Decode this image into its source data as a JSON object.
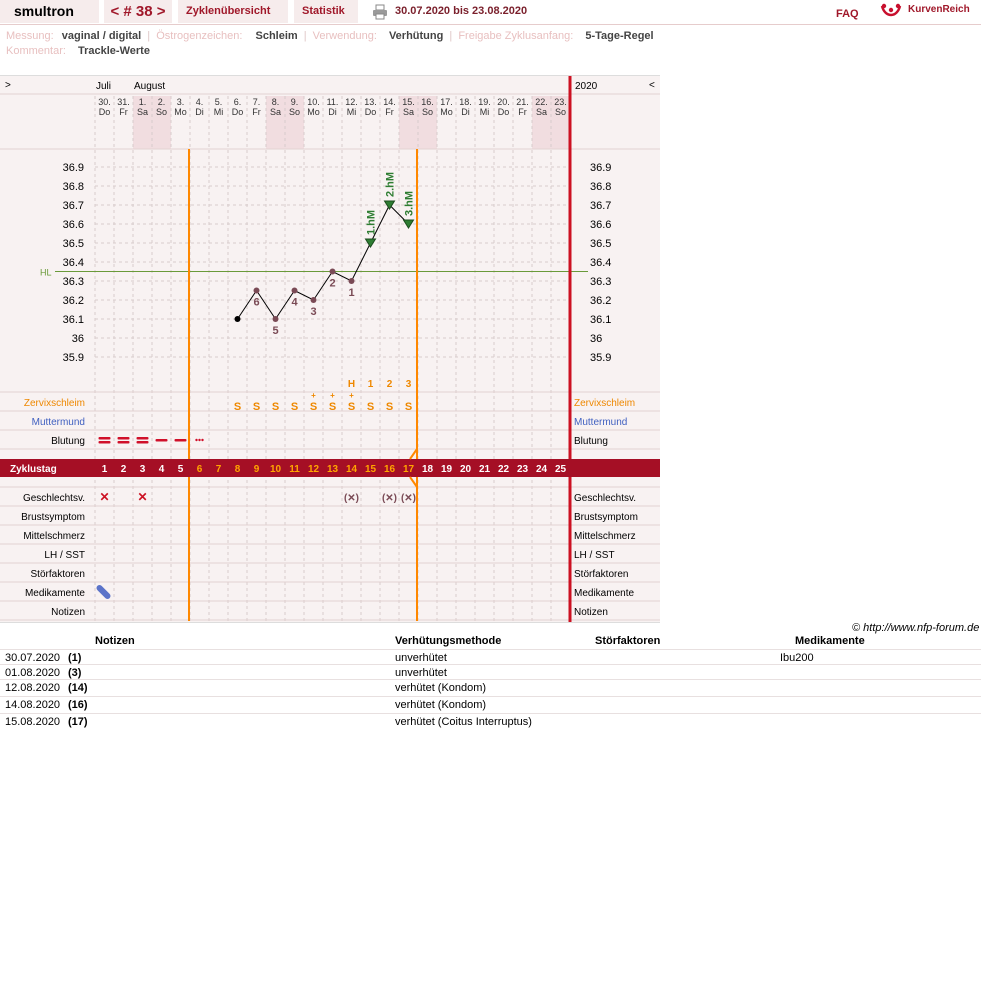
{
  "topbar": {
    "username": "smultron",
    "cycle_nav": "< # 38 >",
    "tab_overview": "Zyklenübersicht",
    "tab_stats": "Statistik",
    "date_range": "30.07.2020 bis 23.08.2020",
    "faq": "FAQ",
    "brand": "KurvenReich"
  },
  "meta": {
    "messung_label": "Messung:",
    "messung_val": "vaginal / digital",
    "oestrogen_label": "Östrogenzeichen:",
    "oestrogen_val": "Schleim",
    "verwendung_label": "Verwendung:",
    "verwendung_val": "Verhütung",
    "freigabe_label": "Freigabe Zyklusanfang:",
    "freigabe_val": "5-Tage-Regel",
    "kommentar_label": "Kommentar:",
    "kommentar_val": "Trackle-Werte"
  },
  "chart": {
    "nav_left": ">",
    "nav_right": "<",
    "year": "2020",
    "month_july": "Juli",
    "month_august": "August",
    "hl_label": "HL",
    "day_numbers": [
      "30.",
      "31.",
      "1.",
      "2.",
      "3.",
      "4.",
      "5.",
      "6.",
      "7.",
      "8.",
      "9.",
      "10.",
      "11.",
      "12.",
      "13.",
      "14.",
      "15.",
      "16.",
      "17.",
      "18.",
      "19.",
      "20.",
      "21.",
      "22.",
      "23."
    ],
    "weekdays": [
      "Do",
      "Fr",
      "Sa",
      "So",
      "Mo",
      "Di",
      "Mi",
      "Do",
      "Fr",
      "Sa",
      "So",
      "Mo",
      "Di",
      "Mi",
      "Do",
      "Fr",
      "Sa",
      "So",
      "Mo",
      "Di",
      "Mi",
      "Do",
      "Fr",
      "Sa",
      "So"
    ],
    "weekend_cols": [
      2,
      3,
      9,
      10,
      16,
      17,
      23,
      24
    ],
    "temp_ticks": [
      "36.9",
      "36.8",
      "36.7",
      "36.6",
      "36.5",
      "36.4",
      "36.3",
      "36.2",
      "36.1",
      "36",
      "35.9"
    ],
    "row_labels": {
      "zervix": "Zervixschleim",
      "muttermund": "Muttermund",
      "blutung": "Blutung",
      "zyklustag": "Zyklustag",
      "gv": "Geschlechtsv.",
      "brust": "Brustsymptom",
      "mittel": "Mittelschmerz",
      "lh": "LH / SST",
      "stoer": "Störfaktoren",
      "medi": "Medikamente",
      "notizen": "Notizen"
    },
    "right_labels": {
      "zervix": "Zervixschleim",
      "muttermund": "Muttermund",
      "blutung": "Blutung",
      "gv": "Geschlechtsv.",
      "brust": "Brustsymptom",
      "mittel": "Mittelschmerz",
      "lh": "LH / SST",
      "stoer": "Störfaktoren",
      "medi": "Medikamente",
      "notizen": "Notizen"
    },
    "temps": [
      {
        "day": 8,
        "temp": 36.1,
        "label": ""
      },
      {
        "day": 9,
        "temp": 36.25,
        "label": "6"
      },
      {
        "day": 10,
        "temp": 36.1,
        "label": "5"
      },
      {
        "day": 11,
        "temp": 36.25,
        "label": "4"
      },
      {
        "day": 12,
        "temp": 36.2,
        "label": "3"
      },
      {
        "day": 13,
        "temp": 36.35,
        "label": "2"
      },
      {
        "day": 14,
        "temp": 36.3,
        "label": "1"
      },
      {
        "day": 15,
        "temp": 36.5,
        "label": "1.hM"
      },
      {
        "day": 16,
        "temp": 36.7,
        "label": "2.hM"
      },
      {
        "day": 17,
        "temp": 36.6,
        "label": "3.hM"
      }
    ],
    "hl_value": 36.35,
    "mucus_peak": [
      {
        "day": 14,
        "label": "H"
      },
      {
        "day": 15,
        "label": "1"
      },
      {
        "day": 16,
        "label": "2"
      },
      {
        "day": 17,
        "label": "3"
      }
    ],
    "mucus": [
      {
        "day": 8,
        "label": "S"
      },
      {
        "day": 9,
        "label": "S"
      },
      {
        "day": 10,
        "label": "S"
      },
      {
        "day": 11,
        "label": "S"
      },
      {
        "day": 12,
        "label": "S+"
      },
      {
        "day": 13,
        "label": "S+"
      },
      {
        "day": 14,
        "label": "S+"
      },
      {
        "day": 15,
        "label": "S"
      },
      {
        "day": 16,
        "label": "S"
      },
      {
        "day": 17,
        "label": "S"
      }
    ],
    "intercourse": [
      {
        "day": 1,
        "label": "✕",
        "protected": false
      },
      {
        "day": 3,
        "label": "✕",
        "protected": false
      },
      {
        "day": 14,
        "label": "(✕)",
        "protected": true
      },
      {
        "day": 16,
        "label": "(✕)",
        "protected": true
      },
      {
        "day": 17,
        "label": "(✕)",
        "protected": true
      }
    ],
    "colors": {
      "accent": "#a50f25",
      "fertile_line": "#ff8800",
      "mucus": "#ee8800",
      "hl_line": "#6a9a3a",
      "muttermund": "#4060c0",
      "peak_marker": "#2e7d32",
      "point": "#7a4a55"
    }
  },
  "copyright": "© http://www.nfp-forum.de",
  "notes_table": {
    "headers": [
      "Notizen",
      "Verhütungsmethode",
      "Störfaktoren",
      "Medikamente"
    ],
    "rows": [
      {
        "date": "30.07.2020",
        "day": "(1)",
        "method": "unverhütet",
        "drug": "Ibu200"
      },
      {
        "date": "01.08.2020",
        "day": "(3)",
        "method": "unverhütet",
        "drug": ""
      },
      {
        "date": "12.08.2020",
        "day": "(14)",
        "method": "verhütet (Kondom)",
        "drug": ""
      },
      {
        "date": "14.08.2020",
        "day": "(16)",
        "method": "verhütet (Kondom)",
        "drug": ""
      },
      {
        "date": "15.08.2020",
        "day": "(17)",
        "method": "verhütet (Coitus Interruptus)",
        "drug": ""
      }
    ]
  }
}
